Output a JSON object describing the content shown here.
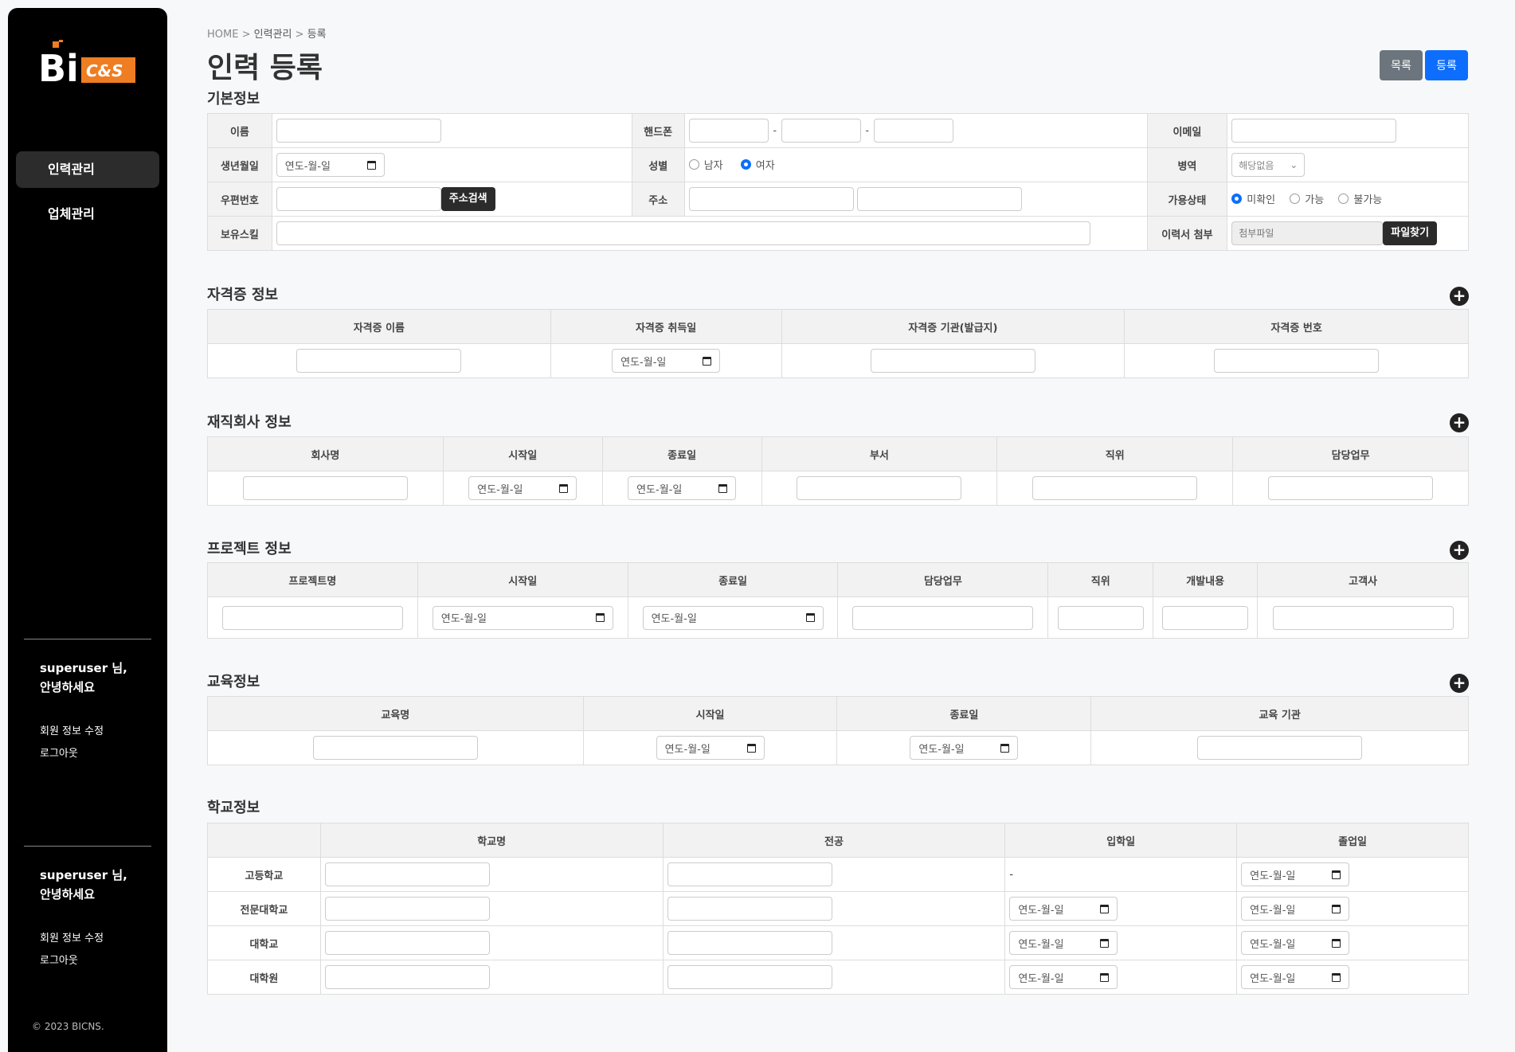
{
  "brand": {
    "logo_main": "Bi",
    "logo_sub": "C&S",
    "logo_accent": "#ef7d22"
  },
  "sidebar": {
    "items": [
      {
        "label": "인력관리"
      },
      {
        "label": "업체관리"
      }
    ],
    "user_blocks": [
      {
        "greet1": "superuser 님,",
        "greet2": "안녕하세요",
        "edit": "회원 정보 수정",
        "logout": "로그아웃"
      },
      {
        "greet1": "superuser 님,",
        "greet2": "안녕하세요",
        "edit": "회원 정보 수정",
        "logout": "로그아웃"
      }
    ],
    "copyright": "© 2023 BICNS."
  },
  "breadcrumb": {
    "home": "HOME",
    "sep": ">",
    "level1": "인력관리",
    "level2": "등록"
  },
  "page_title": "인력 등록",
  "buttons": {
    "list": "목록",
    "register": "등록",
    "addr_search": "주소검색",
    "file_find": "파일찾기"
  },
  "date_placeholder": "연도-월-일",
  "basic": {
    "title": "기본정보",
    "name": "이름",
    "phone": "핸드폰",
    "email": "이메일",
    "birth": "생년월일",
    "gender": "성별",
    "male": "남자",
    "female": "여자",
    "military": "병역",
    "military_value": "해당없음",
    "zip": "우편번호",
    "address": "주소",
    "availability": "가용상태",
    "avail_opts": [
      "미확인",
      "가능",
      "불가능"
    ],
    "skills": "보유스킬",
    "resume": "이력서 첨부",
    "resume_placeholder": "첨부파일"
  },
  "cert": {
    "title": "자격증 정보",
    "headers": [
      "자격증 이름",
      "자격증 취득일",
      "자격증 기관(발급지)",
      "자격증 번호"
    ]
  },
  "career": {
    "title": "재직회사 정보",
    "headers": [
      "회사명",
      "시작일",
      "종료일",
      "부서",
      "직위",
      "담당업무"
    ]
  },
  "project": {
    "title": "프로젝트 정보",
    "headers": [
      "프로젝트명",
      "시작일",
      "종료일",
      "담당업무",
      "직위",
      "개발내용",
      "고객사"
    ]
  },
  "edu": {
    "title": "교육정보",
    "headers": [
      "교육명",
      "시작일",
      "종료일",
      "교육 기관"
    ]
  },
  "school": {
    "title": "학교정보",
    "headers": [
      "학교명",
      "전공",
      "입학일",
      "졸업일"
    ],
    "rows": [
      "고등학교",
      "전문대학교",
      "대학교",
      "대학원"
    ],
    "dash": "-"
  },
  "colors": {
    "sidebar": "#000000",
    "primary": "#0d6efd",
    "secondary": "#6c757d"
  }
}
